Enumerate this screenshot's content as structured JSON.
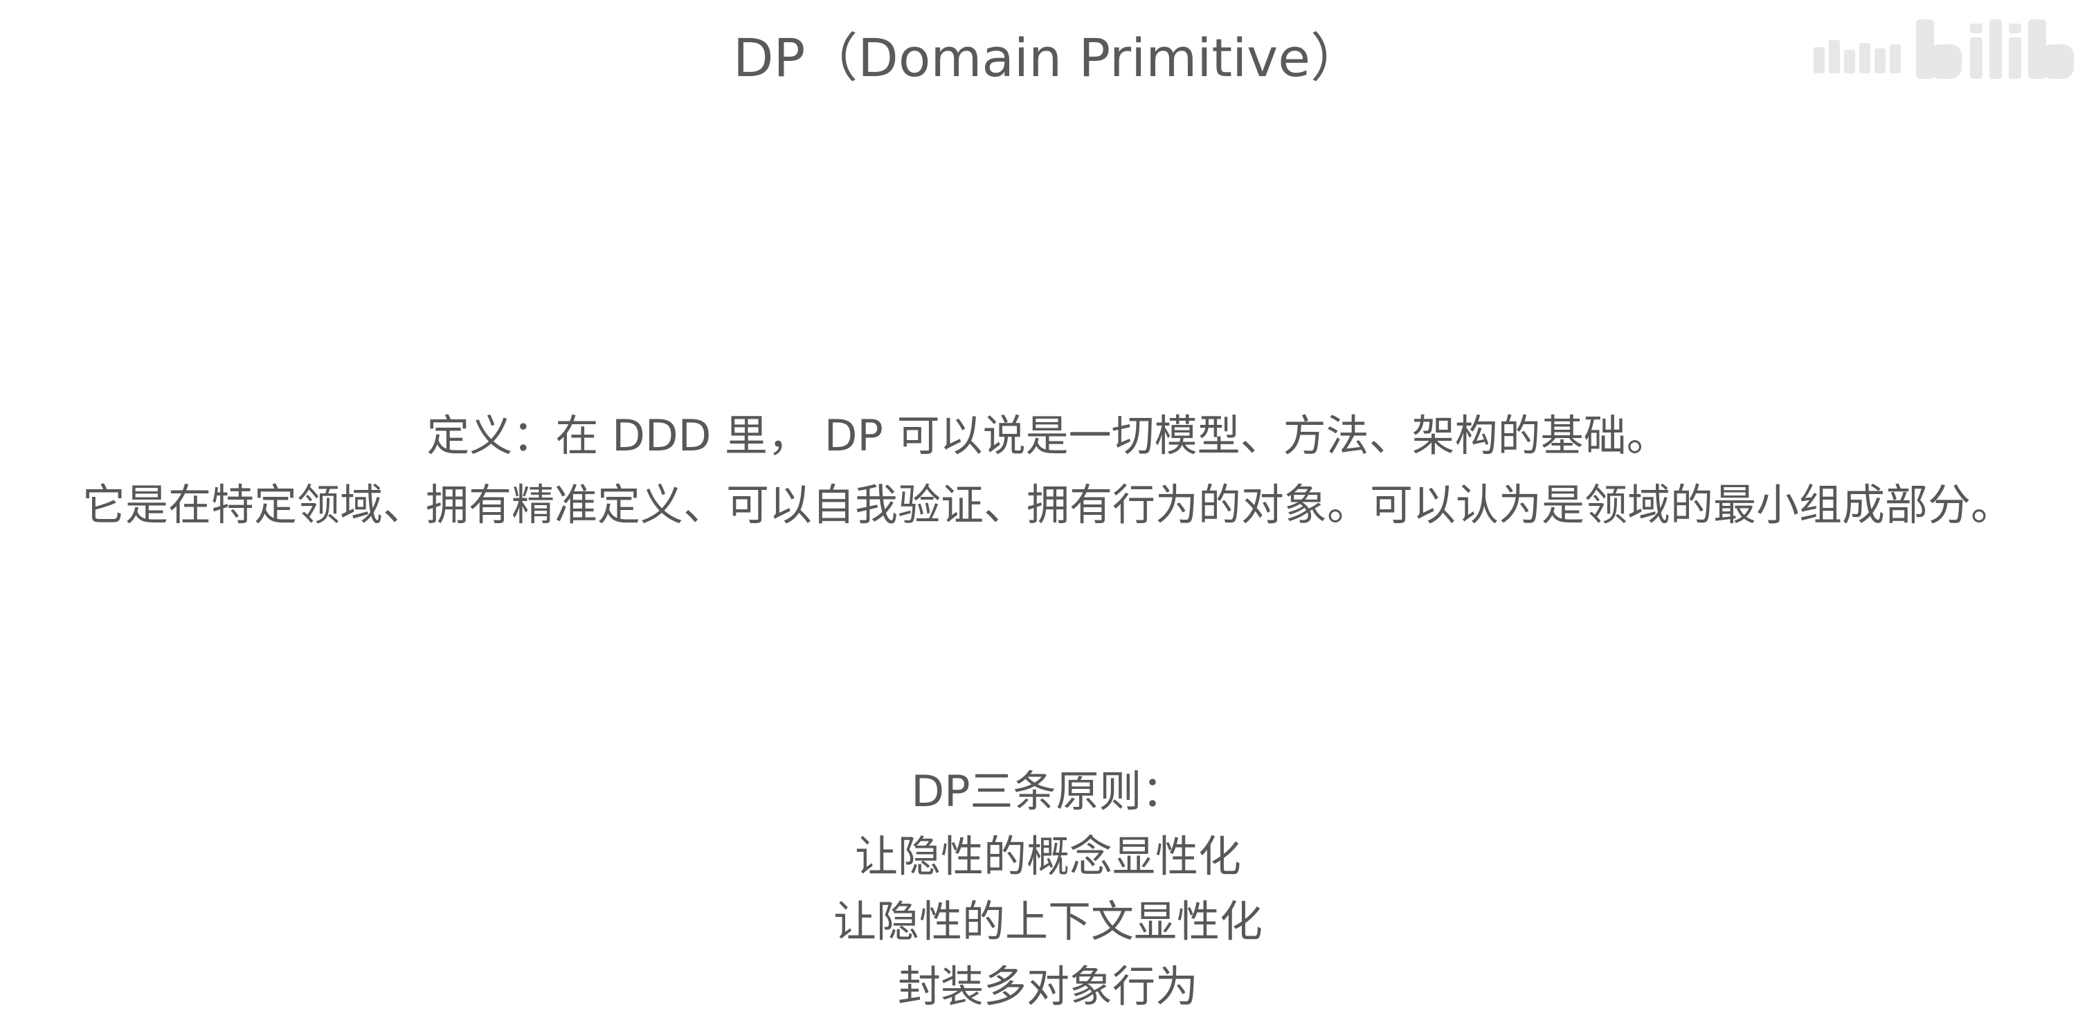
{
  "slide": {
    "title": "DP（Domain Primitive）",
    "definition": {
      "line1": "定义：在 DDD 里， DP 可以说是一切模型、方法、架构的基础。",
      "line2": "它是在特定领域、拥有精准定义、可以自我验证、拥有行为的对象。可以认为是领域的最小组成部分。"
    },
    "principles": {
      "heading": "DP三条原则：",
      "items": [
        "让隐性的概念显性化",
        "让隐性的上下文显性化",
        "封装多对象行为"
      ]
    },
    "watermark": {
      "logo": "bilibili-logo",
      "text": "bilibili"
    }
  }
}
